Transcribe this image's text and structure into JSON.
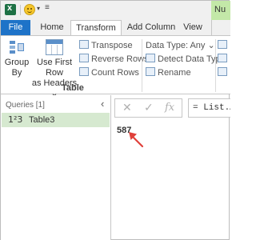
{
  "quick_access": {
    "excel_icon": "excel-icon",
    "smiley_icon": "smiley-icon",
    "more_icon": "customize-quick-access-icon"
  },
  "tabs": [
    {
      "label": "File"
    },
    {
      "label": "Home"
    },
    {
      "label": "Transform"
    },
    {
      "label": "Add Column"
    },
    {
      "label": "View"
    },
    {
      "label": "|"
    }
  ],
  "context_tab_partial": "Nu",
  "ribbon": {
    "group_by": {
      "line1": "Group",
      "line2": "By"
    },
    "use_first_row": {
      "line1": "Use First Row",
      "line2": "as Headers ⌄"
    },
    "transpose": "Transpose",
    "reverse_rows": "Reverse Rows",
    "count_rows": "Count Rows",
    "table_group_label": "Table",
    "data_type": "Data Type: Any ⌄",
    "detect_data_type": "Detect Data Type",
    "rename": "Rename"
  },
  "queries": {
    "header": "Queries [1]",
    "items": [
      {
        "type_icon": "1²3",
        "label": "Table3"
      }
    ]
  },
  "formula_bar": {
    "cancel_glyph": "✕",
    "accept_glyph": "✓",
    "fx_glyph": "fx",
    "formula": "= List.Av"
  },
  "result_value": "587",
  "colors": {
    "file_tab": "#1e73c8",
    "selected_query": "#d6e9d0",
    "context_tab": "#c3e8a8",
    "arrow": "#e0403a"
  }
}
